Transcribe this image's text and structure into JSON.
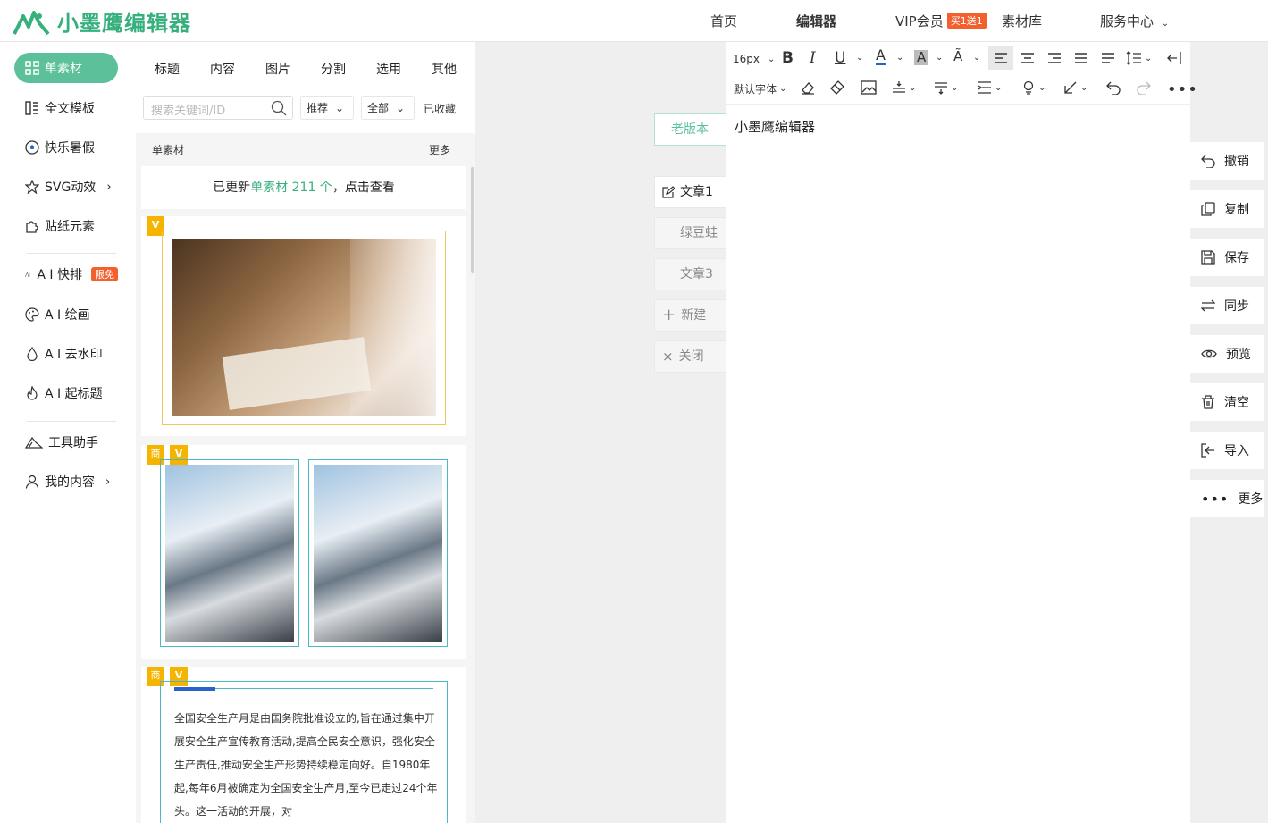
{
  "brand": {
    "name": "小墨鹰编辑器",
    "color": "#36b07c",
    "icon": "eagle-logo-icon"
  },
  "nav": {
    "home": "首页",
    "editor": "编辑器",
    "vip": "VIP会员",
    "vip_badge": "买1送1",
    "library": "素材库",
    "service": "服务中心"
  },
  "sidebar": {
    "items": [
      {
        "label": "单素材",
        "icon": "grid-icon"
      },
      {
        "label": "全文模板",
        "icon": "template-icon"
      },
      {
        "label": "快乐暑假",
        "icon": "soccer-ball-icon"
      },
      {
        "label": "SVG动效",
        "icon": "star-icon"
      },
      {
        "label": "贴纸元素",
        "icon": "puzzle-icon"
      },
      {
        "label": "A I 快排",
        "icon": "ai-icon",
        "badge": "限免"
      },
      {
        "label": "A I 绘画",
        "icon": "palette-icon"
      },
      {
        "label": "A I 去水印",
        "icon": "drop-icon"
      },
      {
        "label": "A I 起标题",
        "icon": "fire-icon"
      },
      {
        "label": "工具助手",
        "icon": "tools-icon"
      },
      {
        "label": "我的内容",
        "icon": "user-icon"
      }
    ]
  },
  "panel": {
    "tabs": [
      "标题",
      "内容",
      "图片",
      "分割",
      "选用",
      "其他"
    ],
    "search_placeholder": "搜索关键词/ID",
    "filter_recommend": "推荐",
    "filter_all": "全部",
    "favorites": "已收藏",
    "section_title": "单素材",
    "section_more": "更多",
    "update_prefix": "已更新",
    "update_highlight": "单素材 211 个",
    "update_suffix": "，点击查看",
    "badge_v": "V",
    "badge_shang": "商",
    "article_text": "全国安全生产月是由国务院批准设立的,旨在通过集中开展安全生产宣传教育活动,提高全民安全意识，强化安全生产责任,推动安全生产形势持续稳定向好。自1980年起,每年6月被确定为全国安全生产月,至今已走过24个年头。这一活动的开展，对"
  },
  "version": {
    "old": "老版本"
  },
  "docs": {
    "tabs": [
      "文章1",
      "绿豆蛙",
      "文章3"
    ],
    "new": "新建",
    "close": "关闭"
  },
  "toolbar": {
    "font_size": "16px",
    "font_family": "默认字体"
  },
  "editor": {
    "title": "小墨鹰编辑器"
  },
  "actions": [
    {
      "label": "撤销",
      "icon": "undo-icon"
    },
    {
      "label": "复制",
      "icon": "copy-icon"
    },
    {
      "label": "保存",
      "icon": "save-icon"
    },
    {
      "label": "同步",
      "icon": "sync-icon"
    },
    {
      "label": "预览",
      "icon": "eye-icon"
    },
    {
      "label": "清空",
      "icon": "trash-icon"
    },
    {
      "label": "导入",
      "icon": "import-icon"
    },
    {
      "label": "更多",
      "icon": "more-icon"
    }
  ]
}
